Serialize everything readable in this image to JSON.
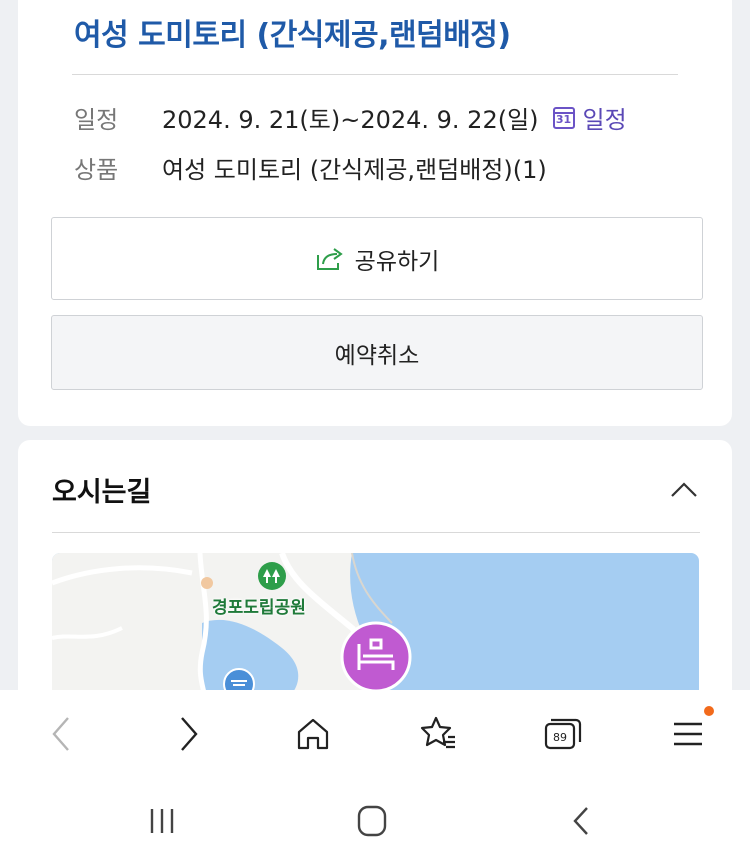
{
  "product": {
    "title": "여성 도미토리 (간식제공,랜덤배정)",
    "schedule_label": "일정",
    "schedule_value": "2024. 9. 21(토)~2024. 9. 22(일)",
    "calendar_day": "31",
    "calendar_link": "일정",
    "item_label": "상품",
    "item_value": "여성 도미토리 (간식제공,랜덤배정)(1)"
  },
  "buttons": {
    "share": "공유하기",
    "cancel": "예약취소"
  },
  "directions": {
    "title": "오시는길",
    "map_park_label": "경포도립공원"
  },
  "browser": {
    "tab_count": "89"
  },
  "colors": {
    "title_blue": "#1f5aa8",
    "calendar_purple": "#6b53c6",
    "map_water": "#a5cdf2",
    "lodging_marker": "#c05ad1",
    "notification_dot": "#f26a1b"
  }
}
